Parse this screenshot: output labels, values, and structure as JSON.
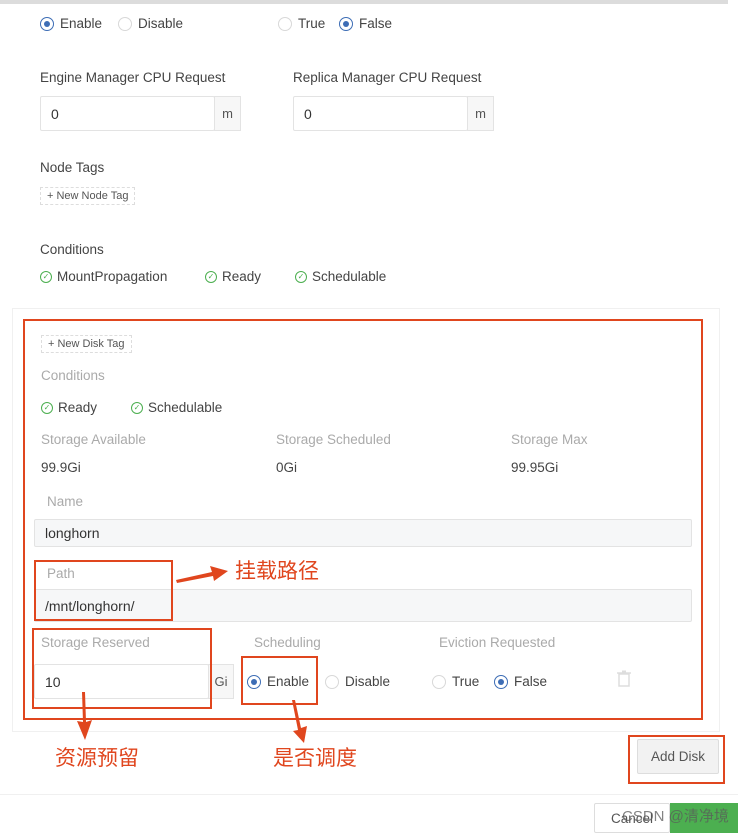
{
  "top_row": {
    "enable": "Enable",
    "disable": "Disable",
    "true": "True",
    "false": "False"
  },
  "engine_cpu": {
    "label": "Engine Manager CPU Request",
    "value": "0",
    "unit": "m"
  },
  "replica_cpu": {
    "label": "Replica Manager CPU Request",
    "value": "0",
    "unit": "m"
  },
  "node_tags": {
    "label": "Node Tags",
    "button": "+ New Node Tag"
  },
  "node_conditions": {
    "label": "Conditions",
    "items": [
      "MountPropagation",
      "Ready",
      "Schedulable"
    ]
  },
  "disk": {
    "new_tag": "+ New Disk Tag",
    "conditions_label": "Conditions",
    "conditions": [
      "Ready",
      "Schedulable"
    ],
    "storage_available": {
      "label": "Storage Available",
      "value": "99.9Gi"
    },
    "storage_scheduled": {
      "label": "Storage Scheduled",
      "value": "0Gi"
    },
    "storage_max": {
      "label": "Storage Max",
      "value": "99.95Gi"
    },
    "name": {
      "label": "Name",
      "value": "longhorn"
    },
    "path": {
      "label": "Path",
      "value": "/mnt/longhorn/"
    },
    "storage_reserved": {
      "label": "Storage Reserved",
      "value": "10",
      "unit": "Gi"
    },
    "scheduling": {
      "label": "Scheduling",
      "enable": "Enable",
      "disable": "Disable"
    },
    "eviction": {
      "label": "Eviction Requested",
      "true": "True",
      "false": "False"
    }
  },
  "annotations": {
    "path": "挂载路径",
    "reserved": "资源预留",
    "scheduling": "是否调度"
  },
  "add_disk": "Add Disk",
  "footer": {
    "cancel": "Cancel"
  },
  "watermark": "CSDN @清净境",
  "colors": {
    "accent": "#3d6db5",
    "success": "#4caf50",
    "annotation": "#e0461e",
    "save": "#4caf50"
  }
}
